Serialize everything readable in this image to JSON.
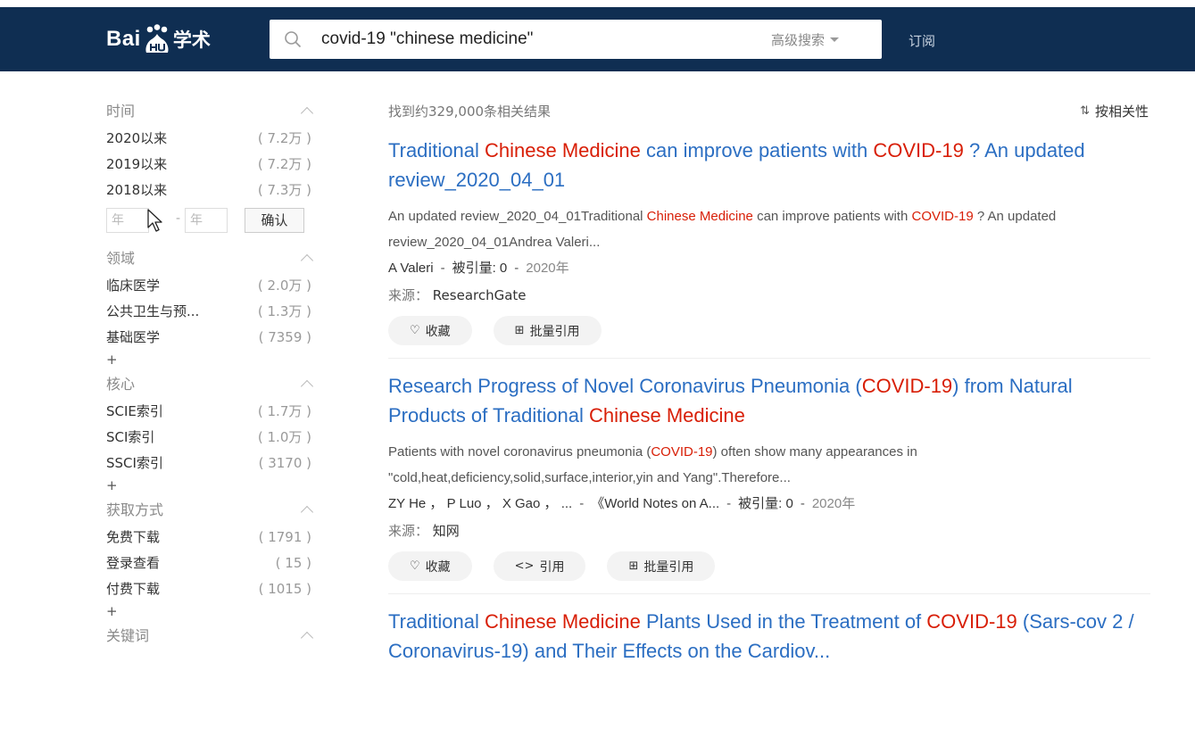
{
  "header": {
    "logo_text": "Bai",
    "logo_suffix": "学术",
    "search_value": "covid-19 \"chinese medicine\"",
    "advanced_search": "高级搜索",
    "subscribe": "订阅"
  },
  "sidebar": {
    "time": {
      "title": "时间",
      "items": [
        {
          "label": "2020以来",
          "count": "( 7.2万 )"
        },
        {
          "label": "2019以来",
          "count": "( 7.2万 )"
        },
        {
          "label": "2018以来",
          "count": "( 7.3万 )"
        }
      ],
      "year_from_placeholder": "年",
      "year_to_placeholder": "年",
      "dash": "-",
      "confirm": "确认"
    },
    "field": {
      "title": "领域",
      "items": [
        {
          "label": "临床医学",
          "count": "( 2.0万 )"
        },
        {
          "label": "公共卫生与预...",
          "count": "( 1.3万 )"
        },
        {
          "label": "基础医学",
          "count": "( 7359 )"
        }
      ],
      "more": "+"
    },
    "core": {
      "title": "核心",
      "items": [
        {
          "label": "SCIE索引",
          "count": "( 1.7万 )"
        },
        {
          "label": "SCI索引",
          "count": "( 1.0万 )"
        },
        {
          "label": "SSCI索引",
          "count": "( 3170 )"
        }
      ],
      "more": "+"
    },
    "access": {
      "title": "获取方式",
      "items": [
        {
          "label": "免费下载",
          "count": "( 1791 )"
        },
        {
          "label": "登录查看",
          "count": "( 15 )"
        },
        {
          "label": "付费下载",
          "count": "( 1015 )"
        }
      ],
      "more": "+"
    },
    "keywords": {
      "title": "关键词"
    }
  },
  "main": {
    "result_count": "找到约329,000条相关结果",
    "sort_label": "按相关性",
    "results": [
      {
        "title_parts": [
          "Traditional ",
          "Chinese Medicine",
          " can improve patients with ",
          "COVID-19",
          " ? An updated review_2020_04_01"
        ],
        "abstract_parts": [
          "An updated review_2020_04_01Traditional ",
          "Chinese Medicine",
          " can improve patients with ",
          "COVID-19",
          " ? An updated review_2020_04_01Andrea Valeri..."
        ],
        "authors": "A Valeri",
        "citations": "被引量: 0",
        "year": "2020年",
        "source_label": "来源：",
        "source": "ResearchGate",
        "buttons": [
          "收藏",
          "批量引用"
        ]
      },
      {
        "title_parts": [
          "Research Progress of Novel Coronavirus Pneumonia (",
          "COVID-19",
          ") from Natural Products of Traditional ",
          "Chinese Medicine",
          ""
        ],
        "abstract_parts": [
          "Patients with novel coronavirus pneumonia (",
          "COVID-19",
          ") often show many appearances in \"cold,heat,deficiency,solid,surface,interior,yin and Yang\".Therefore...",
          "",
          ""
        ],
        "authors": "ZY He ， P Luo ， X Gao ， ...",
        "journal": "《World Notes on A...",
        "citations": "被引量: 0",
        "year": "2020年",
        "source_label": "来源：",
        "source": "知网",
        "buttons": [
          "收藏",
          "引用",
          "批量引用"
        ]
      },
      {
        "title_parts": [
          "Traditional ",
          "Chinese Medicine",
          " Plants Used in the Treatment of ",
          "COVID-19",
          " (Sars-cov 2 / Coronavirus-19) and Their Effects on the Cardiov..."
        ]
      }
    ]
  },
  "icons": {
    "search": "search-icon",
    "heart": "heart-icon",
    "folder_plus": "folder-plus-icon",
    "code": "code-icon",
    "sort": "sort-icon",
    "chevron": "chevron-up-icon"
  },
  "colors": {
    "header_bg": "#0f2e52",
    "link": "#2b6ec2",
    "highlight": "#d81e06"
  }
}
